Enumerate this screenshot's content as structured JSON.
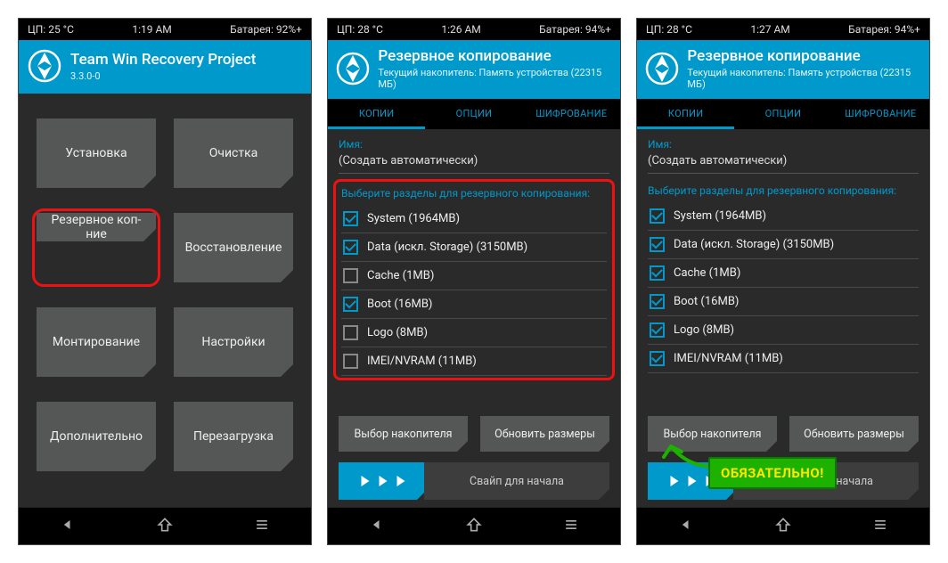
{
  "screens": [
    {
      "status": {
        "cpu": "ЦП: 25 °C",
        "time": "1:19 AM",
        "battery": "Батарея: 92%+"
      },
      "header": {
        "title": "Team Win Recovery Project",
        "sub": "3.3.0-0"
      },
      "menu": [
        "Установка",
        "Очистка",
        "Резервное коп-ние",
        "Восстановление",
        "Монтирование",
        "Настройки",
        "Дополнительно",
        "Перезагрузка"
      ],
      "highlight_index": 2
    },
    {
      "status": {
        "cpu": "ЦП: 28 °C",
        "time": "1:26 AM",
        "battery": "Батарея: 94%+"
      },
      "header": {
        "title": "Резервное копирование",
        "sub": "Текущий накопитель: Память устройства (22315 МБ)"
      },
      "tabs": [
        "КОПИИ",
        "ОПЦИИ",
        "ШИФРОВАНИЕ"
      ],
      "name_label": "Имя:",
      "name_value": "(Создать автоматически)",
      "section_label": "Выберите разделы для резервного копирования:",
      "partitions": [
        {
          "label": "System (1964MB)",
          "checked": true
        },
        {
          "label": "Data (искл. Storage) (3150MB)",
          "checked": true
        },
        {
          "label": "Cache (1MB)",
          "checked": false
        },
        {
          "label": "Boot (16MB)",
          "checked": true
        },
        {
          "label": "Logo (8MB)",
          "checked": false
        },
        {
          "label": "IMEI/NVRAM (11MB)",
          "checked": false
        }
      ],
      "highlight_partitions": true,
      "buttons": {
        "storage": "Выбор накопителя",
        "refresh": "Обновить размеры"
      },
      "swipe_label": "Свайп для начала"
    },
    {
      "status": {
        "cpu": "ЦП: 28 °C",
        "time": "1:27 AM",
        "battery": "Батарея: 94%+"
      },
      "header": {
        "title": "Резервное копирование",
        "sub": "Текущий накопитель: Память устройства (22315 МБ)"
      },
      "tabs": [
        "КОПИИ",
        "ОПЦИИ",
        "ШИФРОВАНИЕ"
      ],
      "name_label": "Имя:",
      "name_value": "(Создать автоматически)",
      "section_label": "Выберите разделы для резервного копирования:",
      "partitions": [
        {
          "label": "System (1964MB)",
          "checked": true
        },
        {
          "label": "Data (искл. Storage) (3150MB)",
          "checked": true
        },
        {
          "label": "Cache (1MB)",
          "checked": true
        },
        {
          "label": "Boot (16MB)",
          "checked": true
        },
        {
          "label": "Logo (8MB)",
          "checked": true
        },
        {
          "label": "IMEI/NVRAM (11MB)",
          "checked": true
        }
      ],
      "buttons": {
        "storage": "Выбор накопителя",
        "refresh": "Обновить размеры"
      },
      "swipe_label": "Свайп для начала",
      "callout": "ОБЯЗАТЕЛЬНО!"
    }
  ]
}
